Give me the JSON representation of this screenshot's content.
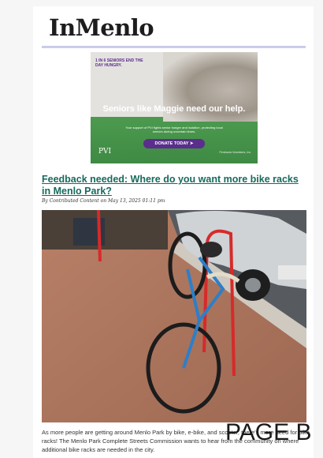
{
  "site": {
    "name": "InMenlo"
  },
  "ad": {
    "tagline": "1 IN 6 SENIORS END THE DAY HUNGRY.",
    "headline": "Seniors like Maggie need our help.",
    "body": "Your support of PVI fights senior hunger and isolation, protecting local seniors during uncertain times.",
    "button_label": "DONATE TODAY",
    "logo": "PVI",
    "org_text": "Peninsula Volunteers, Inc."
  },
  "article": {
    "headline": "Feedback needed: Where do you want more bike racks in Menlo Park?",
    "byline": "By Contributed Content on May 13, 2025 01:11 pm",
    "excerpt": "As more people are getting around Menlo Park by bike, e-bike, and scooter, there's more need for bike racks! The Menlo Park Complete Streets Commission wants to hear from the community on where additional bike racks are needed in the city."
  },
  "overlay": {
    "text": "PAGE B"
  },
  "colors": {
    "headline_link": "#176a5c",
    "ad_purple": "#5b2d8c",
    "ad_green": "#4c9a4f"
  }
}
